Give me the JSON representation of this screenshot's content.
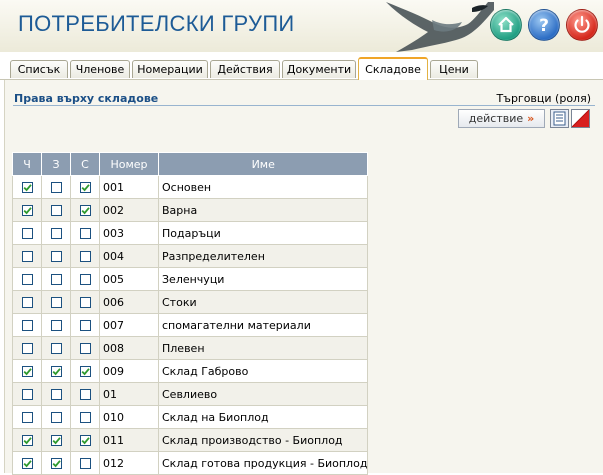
{
  "app": {
    "title": "ПОТРЕБИТЕЛСКИ ГРУПИ"
  },
  "header_buttons": {
    "home": "home-icon",
    "help": "help-icon",
    "power": "power-icon"
  },
  "tabs": [
    {
      "label": "Списък",
      "active": false
    },
    {
      "label": "Членове",
      "active": false
    },
    {
      "label": "Номерации",
      "active": false
    },
    {
      "label": "Действия",
      "active": false
    },
    {
      "label": "Документи",
      "active": false
    },
    {
      "label": "Складове",
      "active": true
    },
    {
      "label": "Цени",
      "active": false
    }
  ],
  "panel": {
    "title": "Права върху складове",
    "role": "Търговци (роля)",
    "action_label": "действие",
    "action_arrow": "»"
  },
  "colors": {
    "accent": "#1d5b96",
    "header_bg": "#ecead9",
    "table_header": "#8c9db1",
    "check": "#2e9a2e"
  },
  "table": {
    "columns": [
      "Ч",
      "З",
      "С",
      "Номер",
      "Име"
    ],
    "rows": [
      {
        "read": true,
        "write": false,
        "create": true,
        "number": "001",
        "name": "Основен"
      },
      {
        "read": true,
        "write": false,
        "create": true,
        "number": "002",
        "name": "Варна"
      },
      {
        "read": false,
        "write": false,
        "create": false,
        "number": "003",
        "name": "Подаръци"
      },
      {
        "read": false,
        "write": false,
        "create": false,
        "number": "004",
        "name": "Разпределителен"
      },
      {
        "read": false,
        "write": false,
        "create": false,
        "number": "005",
        "name": "Зеленчуци"
      },
      {
        "read": false,
        "write": false,
        "create": false,
        "number": "006",
        "name": "Стоки"
      },
      {
        "read": false,
        "write": false,
        "create": false,
        "number": "007",
        "name": "спомагателни материали"
      },
      {
        "read": false,
        "write": false,
        "create": false,
        "number": "008",
        "name": "Плевен"
      },
      {
        "read": true,
        "write": true,
        "create": true,
        "number": "009",
        "name": "Склад Габрово"
      },
      {
        "read": false,
        "write": false,
        "create": false,
        "number": "01",
        "name": "Севлиево"
      },
      {
        "read": false,
        "write": false,
        "create": false,
        "number": "010",
        "name": "Склад на Биоплод"
      },
      {
        "read": true,
        "write": true,
        "create": true,
        "number": "011",
        "name": "Склад производство - Биоплод"
      },
      {
        "read": true,
        "write": true,
        "create": false,
        "number": "012",
        "name": "Склад готова продукция - Биоплод"
      }
    ]
  }
}
